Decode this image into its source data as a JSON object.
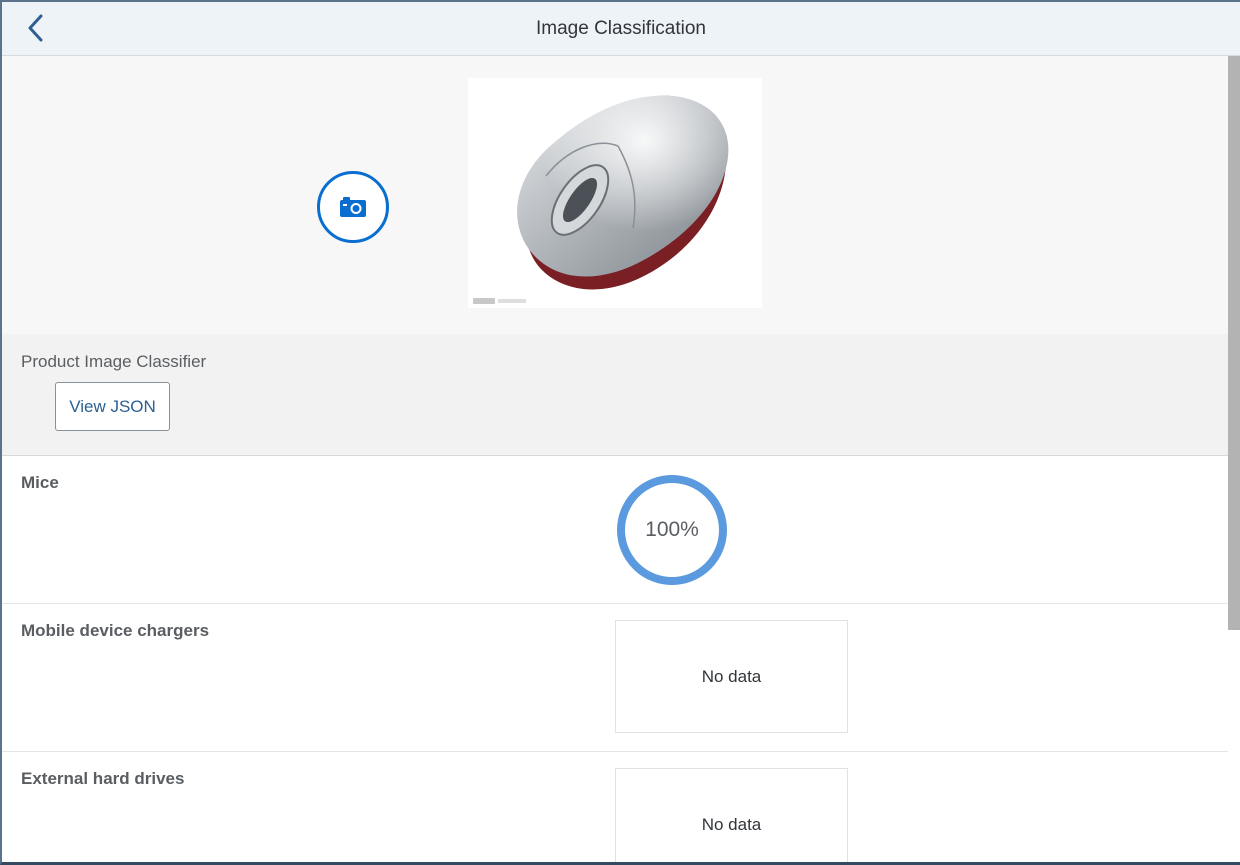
{
  "header": {
    "title": "Image Classification"
  },
  "image_section": {
    "image_caption": ""
  },
  "classifier": {
    "label": "Product Image Classifier",
    "view_json_label": "View JSON"
  },
  "results": [
    {
      "label": "Mice",
      "percent_text": "100%",
      "percent_value": 100
    },
    {
      "label": "Mobile device chargers",
      "status": "No data"
    },
    {
      "label": "External hard drives",
      "status": "No data"
    }
  ],
  "colors": {
    "accent": "#0a6ed1",
    "ring": "#5b9ade",
    "header_bg": "#eef3f8"
  }
}
